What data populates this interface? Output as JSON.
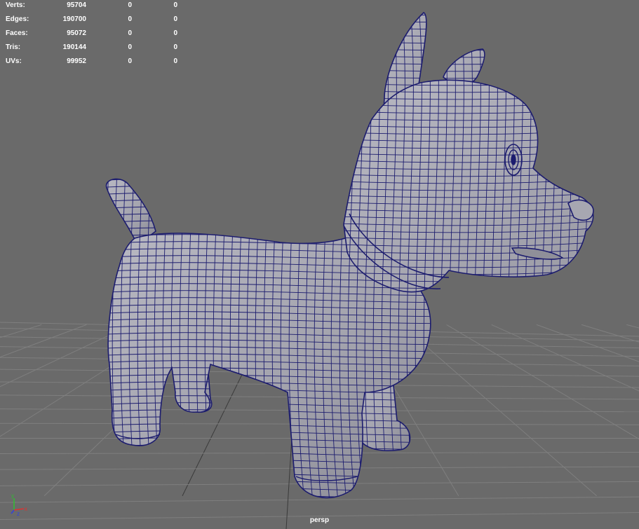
{
  "hud": {
    "rows": [
      {
        "label": "Verts:",
        "total": "95704",
        "selected": "0",
        "extra": "0"
      },
      {
        "label": "Edges:",
        "total": "190700",
        "selected": "0",
        "extra": "0"
      },
      {
        "label": "Faces:",
        "total": "95072",
        "selected": "0",
        "extra": "0"
      },
      {
        "label": "Tris:",
        "total": "190144",
        "selected": "0",
        "extra": "0"
      },
      {
        "label": "UVs:",
        "total": "99952",
        "selected": "0",
        "extra": "0"
      }
    ]
  },
  "camera": {
    "name": "persp"
  },
  "axis": {
    "y": "y",
    "x": "x",
    "z": "z"
  },
  "colors": {
    "background": "#6a6a6a",
    "grid": "#7f7f7f",
    "grid_axis": "#3a3a3a",
    "mesh_fill": "#a3a3ad",
    "wireframe": "#1c1c6e"
  }
}
